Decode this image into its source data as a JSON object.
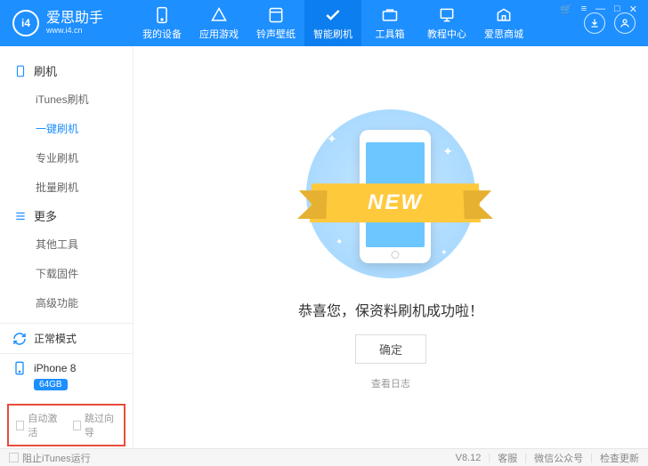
{
  "app": {
    "name": "爱思助手",
    "site": "www.i4.cn",
    "logo_text": "i4"
  },
  "nav": [
    {
      "label": "我的设备"
    },
    {
      "label": "应用游戏"
    },
    {
      "label": "铃声壁纸"
    },
    {
      "label": "智能刷机",
      "active": true
    },
    {
      "label": "工具箱"
    },
    {
      "label": "教程中心"
    },
    {
      "label": "爱思商城"
    }
  ],
  "window_controls": {
    "cart": "🛒",
    "menu": "≡",
    "min": "—",
    "max": "□",
    "close": "✕"
  },
  "sidebar": {
    "groups": [
      {
        "label": "刷机",
        "items": [
          {
            "label": "iTunes刷机"
          },
          {
            "label": "一键刷机",
            "active": true
          },
          {
            "label": "专业刷机"
          },
          {
            "label": "批量刷机"
          }
        ]
      },
      {
        "label": "更多",
        "items": [
          {
            "label": "其他工具"
          },
          {
            "label": "下载固件"
          },
          {
            "label": "高级功能"
          }
        ]
      }
    ],
    "status": "正常模式",
    "device": {
      "name": "iPhone 8",
      "storage": "64GB"
    },
    "options": {
      "auto_activate": "自动激活",
      "skip_guide": "跳过向导"
    }
  },
  "main": {
    "ribbon": "NEW",
    "message": "恭喜您，保资料刷机成功啦！",
    "confirm": "确定",
    "log": "查看日志"
  },
  "footer": {
    "block_itunes": "阻止iTunes运行",
    "version": "V8.12",
    "support": "客服",
    "wechat": "微信公众号",
    "update": "检查更新"
  }
}
